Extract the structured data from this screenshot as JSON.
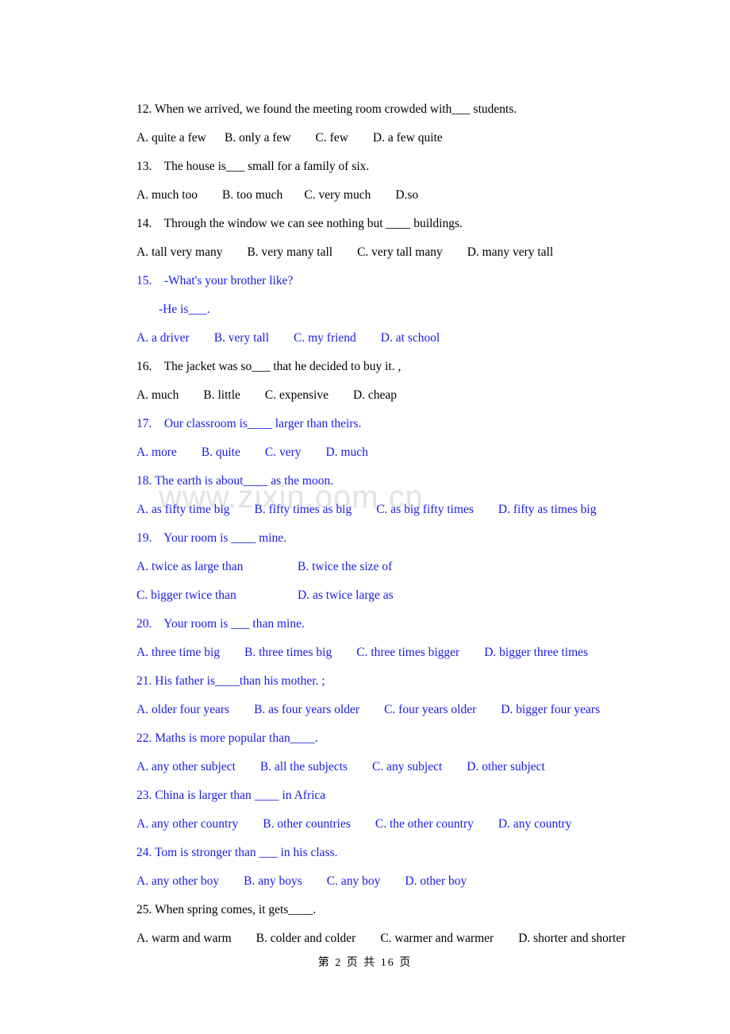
{
  "document": {
    "page_label": "第 2 页 共 16 页",
    "watermark_text": "www.zixin.oom.cn",
    "black_color": "#000000",
    "blue_color": "#1a1ae8",
    "watermark_color": "#e3e3e3"
  },
  "questions": [
    {
      "id": "q12",
      "color": "black",
      "stem": "12. When we arrived, we found the meeting room crowded with___ students.",
      "options_line": "A. quite a few      B. only a few        C. few        D. a few quite"
    },
    {
      "id": "q13",
      "color": "black",
      "stem": "13.    The house is___ small for a family of six.",
      "options_line": "A. much too        B. too much       C. very much        D.so"
    },
    {
      "id": "q14",
      "color": "black",
      "stem": "14.    Through the window we can see nothing but ____ buildings.",
      "options_line": "A. tall very many        B. very many tall        C. very tall many        D. many very tall"
    },
    {
      "id": "q15",
      "color": "blue",
      "stem": "15.    -What's your brother like?",
      "stem_second": "-He is___.",
      "options_line": "A. a driver        B. very tall        C. my friend        D. at school"
    },
    {
      "id": "q16",
      "color": "black",
      "stem": "16.    The jacket was so___ that he decided to buy it. ,",
      "options_line": "A. much        B. little        C. expensive        D. cheap"
    },
    {
      "id": "q17",
      "color": "blue",
      "stem": "17.    Our classroom is____ larger than theirs.",
      "options_line": "A. more        B. quite        C. very        D. much"
    },
    {
      "id": "q18",
      "color": "blue",
      "stem": "18. The earth is about____ as the moon.",
      "options_line": "A. as fifty time big        B. fifty times as big        C. as big fifty times        D. fifty as times big"
    },
    {
      "id": "q19",
      "color": "blue",
      "stem": "19.    Your room is ____ mine.",
      "options_grid": [
        [
          "A. twice as large than",
          "B. twice the size of"
        ],
        [
          "C. bigger twice than",
          "D. as twice large as"
        ]
      ]
    },
    {
      "id": "q20",
      "color": "blue",
      "stem": "20.    Your room is ___ than mine.",
      "options_line": "A. three time big        B. three times big        C. three times bigger        D. bigger three times"
    },
    {
      "id": "q21",
      "color": "blue",
      "stem": "21. His father is____than his mother. ;",
      "options_line": "A. older four years        B. as four years older        C. four years older        D. bigger four years"
    },
    {
      "id": "q22",
      "color": "blue",
      "stem": "22. Maths is more popular than____.",
      "options_line": "A. any other subject        B. all the subjects        C. any subject        D. other subject"
    },
    {
      "id": "q23",
      "color": "blue",
      "stem": "23. China is larger than ____ in Africa",
      "options_line": "A. any other country        B. other countries        C. the other country        D. any country"
    },
    {
      "id": "q24",
      "color": "blue",
      "stem": "24. Tom is stronger than ___ in his class.",
      "options_line": "A. any other boy        B. any boys        C. any boy        D. other boy"
    },
    {
      "id": "q25",
      "color": "black",
      "stem": "25. When spring comes, it gets____.",
      "options_line": "A. warm and warm        B. colder and colder        C. warmer and warmer        D. shorter and shorter"
    }
  ]
}
